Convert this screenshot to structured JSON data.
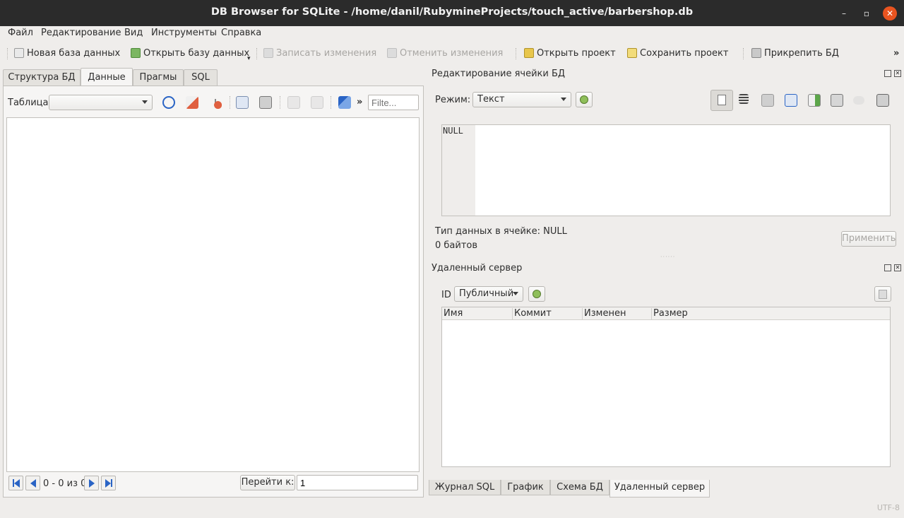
{
  "window": {
    "title": "DB Browser for SQLite - /home/danil/RubymineProjects/touch_active/barbershop.db",
    "minimize": "–",
    "maximize": "▫",
    "close": "✕"
  },
  "menu": [
    "Файл",
    "Редактирование",
    "Вид",
    "Инструменты",
    "Справка"
  ],
  "toolbar": {
    "new_db": "Новая база данных",
    "open_db": "Открыть базу данных",
    "write_changes": "Записать изменения",
    "revert_changes": "Отменить изменения",
    "open_project": "Открыть проект",
    "save_project": "Сохранить проект",
    "attach_db": "Прикрепить БД",
    "more": "»"
  },
  "main_tabs": [
    "Структура БД",
    "Данные",
    "Прагмы",
    "SQL"
  ],
  "active_main_tab": "Данные",
  "browse": {
    "table_label": "Таблица:",
    "table_value": "",
    "more": "»",
    "filter_placeholder": "Filte...",
    "record_count": "0 - 0 из 0",
    "goto_label": "Перейти к:",
    "goto_value": "1"
  },
  "edit_cell": {
    "title": "Редактирование ячейки БД",
    "mode_label": "Режим:",
    "mode_value": "Текст",
    "content": "NULL",
    "type_info": "Тип данных в ячейке: NULL",
    "size_info": "0 байтов",
    "apply": "Применить"
  },
  "remote": {
    "title": "Удаленный сервер",
    "id_label": "ID",
    "id_value": "Публичный",
    "columns": [
      "Имя",
      "Коммит",
      "Изменен",
      "Размер"
    ]
  },
  "bottom_tabs": [
    "Журнал SQL",
    "График",
    "Схема БД",
    "Удаленный сервер"
  ],
  "active_bottom_tab": "Удаленный сервер",
  "status": {
    "encoding": "UTF-8"
  },
  "colors": {
    "titlebar": "#2b2b2b",
    "close": "#e95420",
    "accent": "#2a64c5"
  }
}
